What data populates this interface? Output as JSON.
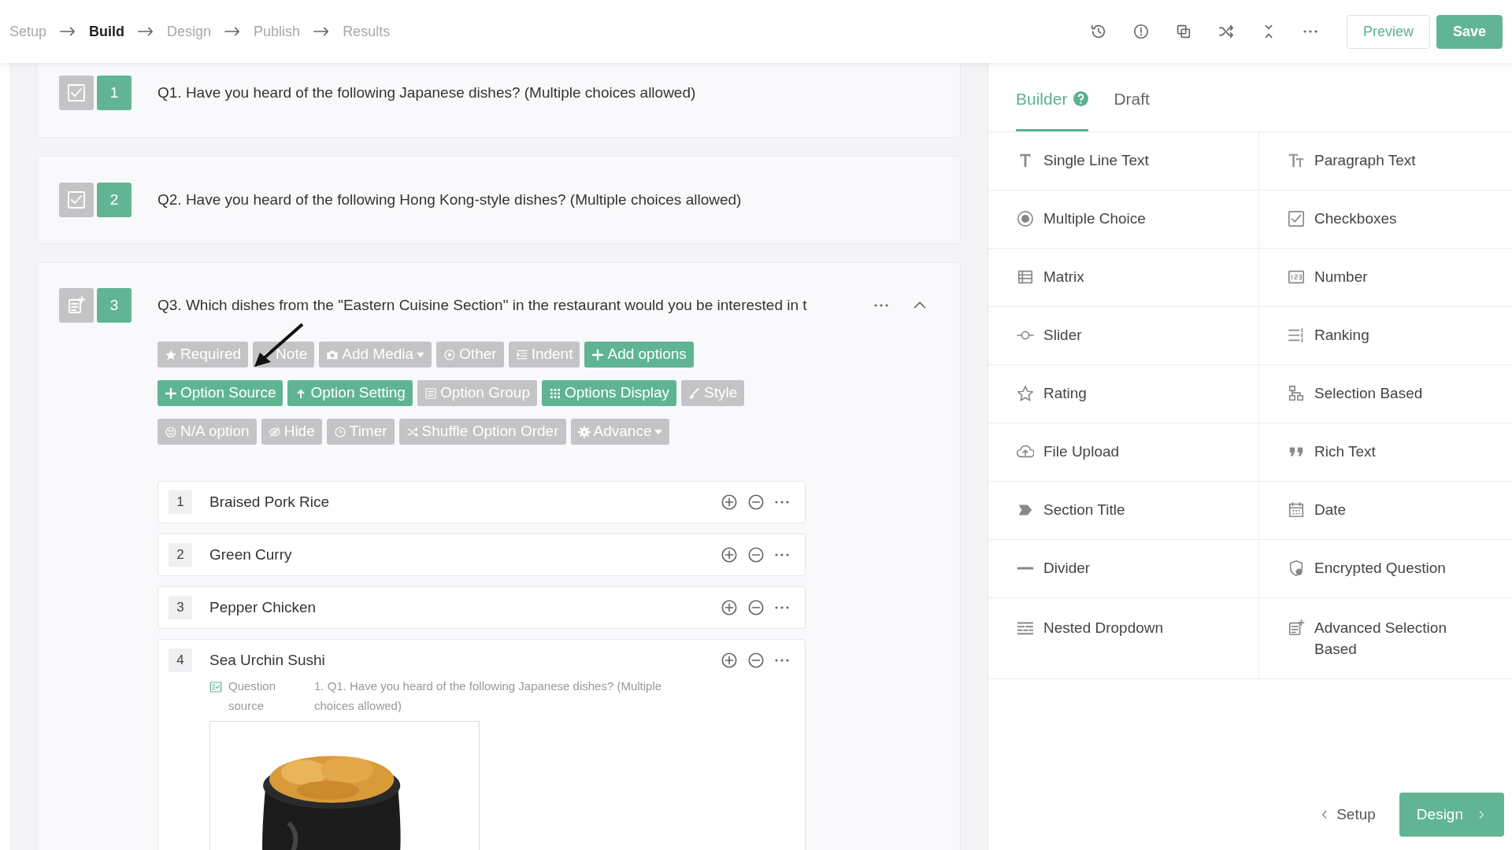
{
  "steps": [
    {
      "label": "Setup",
      "selected": false
    },
    {
      "label": "Build",
      "selected": true
    },
    {
      "label": "Design",
      "selected": false
    },
    {
      "label": "Publish",
      "selected": false
    },
    {
      "label": "Results",
      "selected": false
    }
  ],
  "header_buttons": [
    {
      "label": "Preview",
      "kind": "outline"
    },
    {
      "label": "Save",
      "kind": "primary"
    }
  ],
  "questions": [
    {
      "number": "1",
      "kind": "checkbox",
      "title": "Q1. Have you heard of the following Japanese dishes? (Multiple choices allowed)",
      "expanded": false
    },
    {
      "number": "2",
      "kind": "checkbox",
      "title": "Q2. Have you heard of the following Hong Kong-style dishes? (Multiple choices allowed)",
      "expanded": false
    },
    {
      "number": "3",
      "kind": "advanced",
      "title": "Q3. Which dishes from the \"Eastern Cuisine Section\" in the restaurant would you be interested in t",
      "expanded": true,
      "toolbar": [
        {
          "label": "Required",
          "active": false,
          "kind": "button"
        },
        {
          "label": "Note",
          "active": false,
          "kind": "button"
        },
        {
          "label": "Add Media",
          "active": false,
          "kind": "dropdown"
        },
        {
          "label": "Other",
          "active": false,
          "kind": "button"
        },
        {
          "label": "Indent",
          "active": false,
          "kind": "button"
        },
        {
          "label": "Add options",
          "active": true,
          "kind": "button"
        },
        {
          "label": "Option Source",
          "active": true,
          "kind": "button"
        },
        {
          "label": "Option Setting",
          "active": true,
          "kind": "button"
        },
        {
          "label": "Option Group",
          "active": false,
          "kind": "button"
        },
        {
          "label": "Options Display",
          "active": true,
          "kind": "button"
        },
        {
          "label": "Style",
          "active": false,
          "kind": "button"
        },
        {
          "label": "N/A option",
          "active": false,
          "kind": "button"
        },
        {
          "label": "Hide",
          "active": false,
          "kind": "button"
        },
        {
          "label": "Timer",
          "active": false,
          "kind": "button"
        },
        {
          "label": "Shuffle Option Order",
          "active": false,
          "kind": "button"
        },
        {
          "label": "Advance",
          "active": false,
          "kind": "dropdown"
        }
      ],
      "options": [
        {
          "number": "1",
          "label": "Braised Pork Rice"
        },
        {
          "number": "2",
          "label": "Green Curry"
        },
        {
          "number": "3",
          "label": "Pepper Chicken"
        },
        {
          "number": "4",
          "label": "Sea Urchin Sushi",
          "source_label": "Question source",
          "source": "1. Q1. Have you heard of the following Japanese dishes? (Multiple choices allowed)"
        }
      ]
    }
  ],
  "panel": {
    "tabs": [
      {
        "label": "Builder",
        "selected": true,
        "help": true
      },
      {
        "label": "Draft",
        "selected": false,
        "help": false
      }
    ],
    "field_types": [
      "Single Line Text",
      "Paragraph Text",
      "Multiple Choice",
      "Checkboxes",
      "Matrix",
      "Number",
      "Slider",
      "Ranking",
      "Rating",
      "Selection Based",
      "File Upload",
      "Rich Text",
      "Section Title",
      "Date",
      "Divider",
      "Encrypted Question",
      "Nested Dropdown",
      "Advanced Selection Based"
    ],
    "back": "Setup",
    "next": "Design"
  }
}
